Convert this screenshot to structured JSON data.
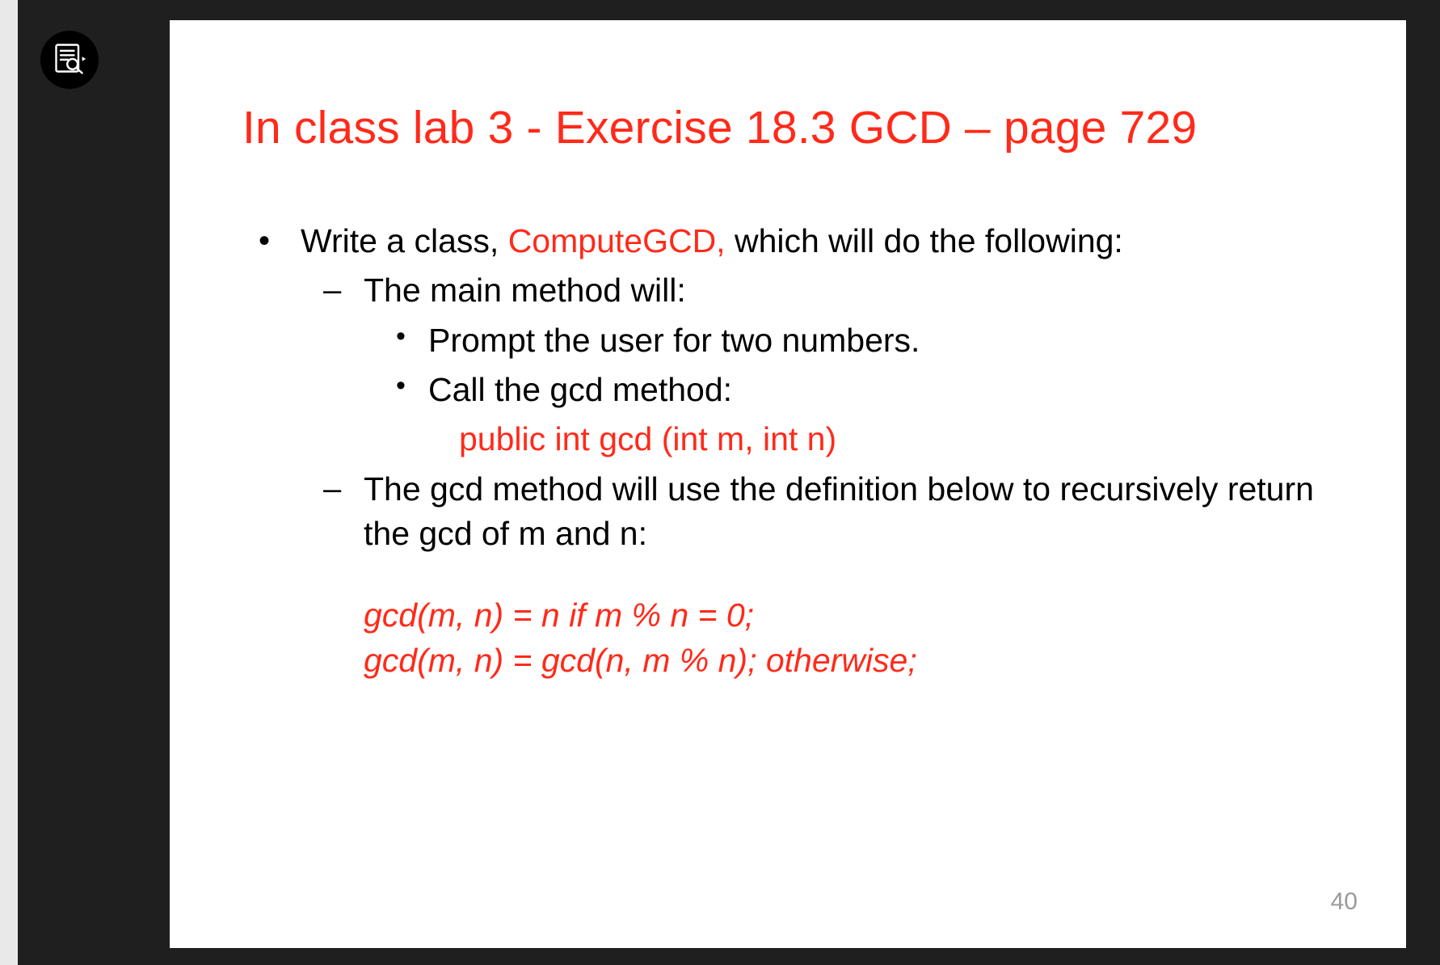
{
  "slide": {
    "title": "In class lab 3 - Exercise 18.3 GCD – page 729",
    "bullet1_pre": "Write a class, ",
    "bullet1_class": "ComputeGCD,",
    "bullet1_post": " which will do the following:",
    "sub1": "The main method will:",
    "sub1a": "Prompt the user for two numbers.",
    "sub1b": "Call the gcd method:",
    "method_sig": "public int gcd (int m, int n)",
    "sub2": "The gcd method will use the definition below to recursively return the gcd of m and n:",
    "def_line1": "gcd(m, n) = n if m % n = 0;",
    "def_line2": "gcd(m, n) = gcd(n, m % n); otherwise;",
    "page_number": "40"
  },
  "icons": {
    "preview_search": "preview-search-icon"
  }
}
